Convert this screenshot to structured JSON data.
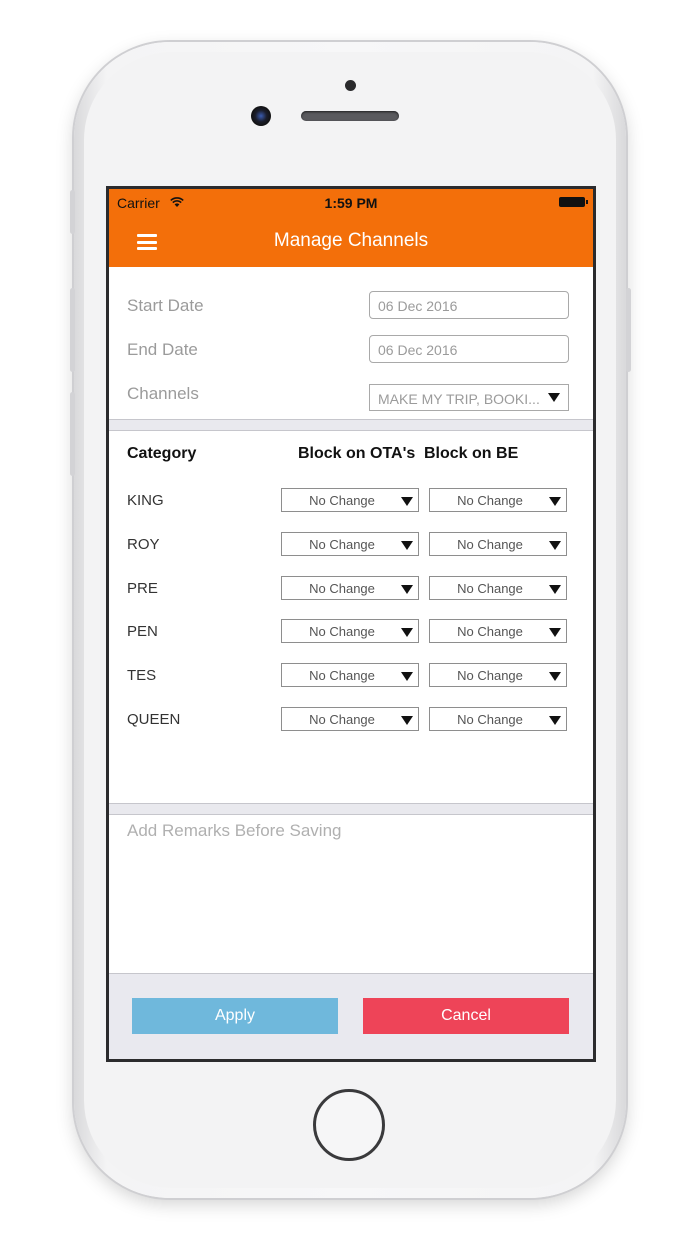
{
  "status_bar": {
    "carrier": "Carrier",
    "time": "1:59 PM"
  },
  "nav": {
    "title": "Manage Channels",
    "menu_icon": "hamburger-menu-icon"
  },
  "form": {
    "start_date_label": "Start Date",
    "start_date_value": "06 Dec 2016",
    "end_date_label": "End Date",
    "end_date_value": "06 Dec 2016",
    "channels_label": "Channels",
    "channels_value": "MAKE MY TRIP, BOOKI..."
  },
  "table": {
    "headers": {
      "category": "Category",
      "ota": "Block on OTA's",
      "be": "Block on BE"
    },
    "rows": [
      {
        "category": "KING",
        "ota": "No Change",
        "be": "No Change"
      },
      {
        "category": "ROY",
        "ota": "No Change",
        "be": "No Change"
      },
      {
        "category": "PRE",
        "ota": "No Change",
        "be": "No Change"
      },
      {
        "category": "PEN",
        "ota": "No Change",
        "be": "No Change"
      },
      {
        "category": "TES",
        "ota": "No Change",
        "be": "No Change"
      },
      {
        "category": "QUEEN",
        "ota": "No Change",
        "be": "No Change"
      }
    ]
  },
  "remarks": {
    "placeholder": "Add Remarks Before Saving"
  },
  "buttons": {
    "apply": "Apply",
    "cancel": "Cancel"
  },
  "colors": {
    "brand_orange": "#f36f0a",
    "apply_blue": "#6fb8dc",
    "cancel_red": "#ee4458"
  }
}
